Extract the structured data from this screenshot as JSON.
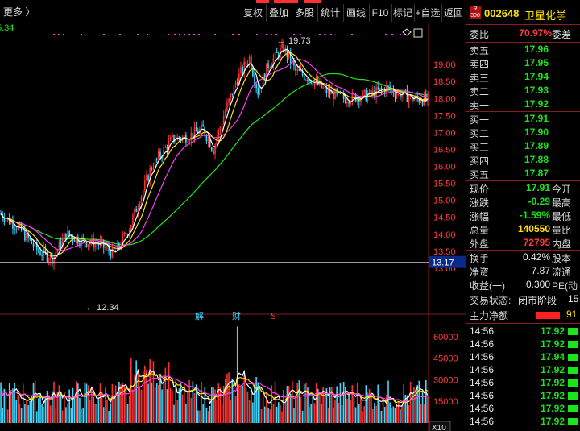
{
  "toolbar": {
    "more": "更多 〉",
    "buttons": [
      "复权",
      "叠加",
      "多股",
      "统计",
      "画线",
      "F10",
      "标记",
      "+自选",
      "返回"
    ]
  },
  "chart": {
    "top_left_value": "5.34",
    "high_label": "19.73",
    "low_label": "12.34",
    "current_price_tag": "13.17",
    "price_ticks": [
      "19.00",
      "18.50",
      "18.00",
      "17.50",
      "17.00",
      "16.50",
      "16.00",
      "15.50",
      "15.00",
      "14.50",
      "14.00",
      "13.50",
      "13.00"
    ],
    "event_markers": [
      "解",
      "财",
      "S"
    ],
    "volume_ticks": [
      "60000",
      "45000",
      "30000",
      "15000"
    ],
    "volume_unit": "X10",
    "colors": {
      "up": "#ff3030",
      "down": "#3fd8ff",
      "ma5": "#ffffff",
      "ma10": "#ffe100",
      "ma20": "#ff3cf0",
      "ma60": "#19e619"
    }
  },
  "panel": {
    "badge": "R 300",
    "code": "002648",
    "name": "卫星化学",
    "weibi_label": "委比",
    "weibi_value": "70.97%",
    "weicha_label": "委差",
    "asks": [
      {
        "label": "卖五",
        "price": "17.96"
      },
      {
        "label": "卖四",
        "price": "17.95"
      },
      {
        "label": "卖三",
        "price": "17.94"
      },
      {
        "label": "卖二",
        "price": "17.93"
      },
      {
        "label": "卖一",
        "price": "17.92"
      }
    ],
    "bids": [
      {
        "label": "买一",
        "price": "17.91"
      },
      {
        "label": "买二",
        "price": "17.90"
      },
      {
        "label": "买三",
        "price": "17.89"
      },
      {
        "label": "买四",
        "price": "17.88"
      },
      {
        "label": "买五",
        "price": "17.87"
      }
    ],
    "quote": [
      {
        "label": "现价",
        "value": "17.91",
        "color": "green",
        "label2": "今开"
      },
      {
        "label": "涨跌",
        "value": "-0.29",
        "color": "green",
        "label2": "最高"
      },
      {
        "label": "涨幅",
        "value": "-1.59%",
        "color": "green",
        "label2": "最低"
      },
      {
        "label": "总量",
        "value": "140550",
        "color": "yellow",
        "label2": "量比"
      },
      {
        "label": "外盘",
        "value": "72795",
        "color": "red",
        "label2": "内盘"
      }
    ],
    "stats": [
      {
        "label": "换手",
        "value": "0.42%",
        "label2": "股本"
      },
      {
        "label": "净资",
        "value": "7.87",
        "label2": "流通"
      },
      {
        "label": "收益(一)",
        "value": "0.300",
        "label2": "PE(动"
      }
    ],
    "trade_status_label": "交易状态:",
    "trade_status_value": "闭市阶段",
    "trade_status_extra": "15",
    "main_flow_label": "主力净额",
    "main_flow_value": "91",
    "ticks": [
      {
        "time": "14:56",
        "price": "17.92"
      },
      {
        "time": "14:56",
        "price": "17.92"
      },
      {
        "time": "14:56",
        "price": "17.94"
      },
      {
        "time": "14:56",
        "price": "17.92"
      },
      {
        "time": "14:56",
        "price": "17.92"
      },
      {
        "time": "14:56",
        "price": "17.92"
      },
      {
        "time": "14:56",
        "price": "17.92"
      },
      {
        "time": "14:56",
        "price": "17.92"
      }
    ]
  }
}
